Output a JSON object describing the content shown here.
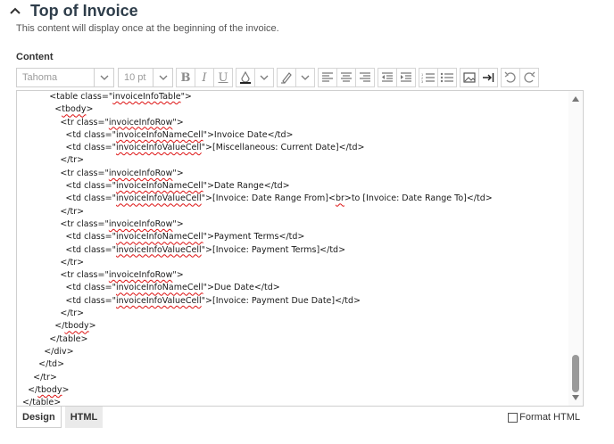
{
  "section": {
    "title": "Top of Invoice",
    "description": "This content will display once at the beginning of the invoice."
  },
  "content_label": "Content",
  "toolbar": {
    "font_family": "Tahoma",
    "font_size": "10 pt",
    "bold": "B",
    "italic": "I",
    "underline": "U"
  },
  "code_lines": [
    [
      {
        "t": "            <table class=\""
      },
      {
        "t": "invoiceInfoTable",
        "s": true
      },
      {
        "t": "\">"
      }
    ],
    [
      {
        "t": "              <"
      },
      {
        "t": "tbody",
        "s": true
      },
      {
        "t": ">"
      }
    ],
    [
      {
        "t": "                <tr class=\""
      },
      {
        "t": "invoiceInfoRow",
        "s": true
      },
      {
        "t": "\">"
      }
    ],
    [
      {
        "t": "                  <td class=\""
      },
      {
        "t": "invoiceInfoNameCell",
        "s": true
      },
      {
        "t": "\">Invoice Date</td>"
      }
    ],
    [
      {
        "t": "                  <td class=\""
      },
      {
        "t": "invoiceInfoValueCell",
        "s": true
      },
      {
        "t": "\">[Miscellaneous: Current Date]</td>"
      }
    ],
    [
      {
        "t": "                </tr>"
      }
    ],
    [
      {
        "t": "                <tr class=\""
      },
      {
        "t": "invoiceInfoRow",
        "s": true
      },
      {
        "t": "\">"
      }
    ],
    [
      {
        "t": "                  <td class=\""
      },
      {
        "t": "invoiceInfoNameCell",
        "s": true
      },
      {
        "t": "\">Date Range</td>"
      }
    ],
    [
      {
        "t": "                  <td class=\""
      },
      {
        "t": "invoiceInfoValueCell",
        "s": true
      },
      {
        "t": "\">[Invoice: Date Range From]<"
      },
      {
        "t": "br",
        "s": true
      },
      {
        "t": ">to [Invoice: Date Range To]</td>"
      }
    ],
    [
      {
        "t": "                </tr>"
      }
    ],
    [
      {
        "t": "                <tr class=\""
      },
      {
        "t": "invoiceInfoRow",
        "s": true
      },
      {
        "t": "\">"
      }
    ],
    [
      {
        "t": "                  <td class=\""
      },
      {
        "t": "invoiceInfoNameCell",
        "s": true
      },
      {
        "t": "\">Payment Terms</td>"
      }
    ],
    [
      {
        "t": "                  <td class=\""
      },
      {
        "t": "invoiceInfoValueCell",
        "s": true
      },
      {
        "t": "\">[Invoice: Payment Terms]</td>"
      }
    ],
    [
      {
        "t": "                </tr>"
      }
    ],
    [
      {
        "t": "                <tr class=\""
      },
      {
        "t": "invoiceInfoRow",
        "s": true
      },
      {
        "t": "\">"
      }
    ],
    [
      {
        "t": "                  <td class=\""
      },
      {
        "t": "invoiceInfoNameCell",
        "s": true
      },
      {
        "t": "\">Due Date</td>"
      }
    ],
    [
      {
        "t": "                  <td class=\""
      },
      {
        "t": "invoiceInfoValueCell",
        "s": true
      },
      {
        "t": "\">[Invoice: Payment Due Date]</td>"
      }
    ],
    [
      {
        "t": "                </tr>"
      }
    ],
    [
      {
        "t": "              </"
      },
      {
        "t": "tbody",
        "s": true
      },
      {
        "t": ">"
      }
    ],
    [
      {
        "t": "            </table>"
      }
    ],
    [
      {
        "t": "          </div>"
      }
    ],
    [
      {
        "t": "        </td>"
      }
    ],
    [
      {
        "t": "      </tr>"
      }
    ],
    [
      {
        "t": "    </"
      },
      {
        "t": "tbody",
        "s": true
      },
      {
        "t": ">"
      }
    ],
    [
      {
        "t": "  </table>"
      }
    ]
  ],
  "tabs": {
    "design": "Design",
    "html": "HTML"
  },
  "format_html": {
    "label": "Format HTML",
    "checked": false
  },
  "colors": {
    "title": "#2e3d4a",
    "border": "#cfcfcf",
    "spellcheck": "#dd1111",
    "scroll_thumb": "#9a9a9a"
  }
}
